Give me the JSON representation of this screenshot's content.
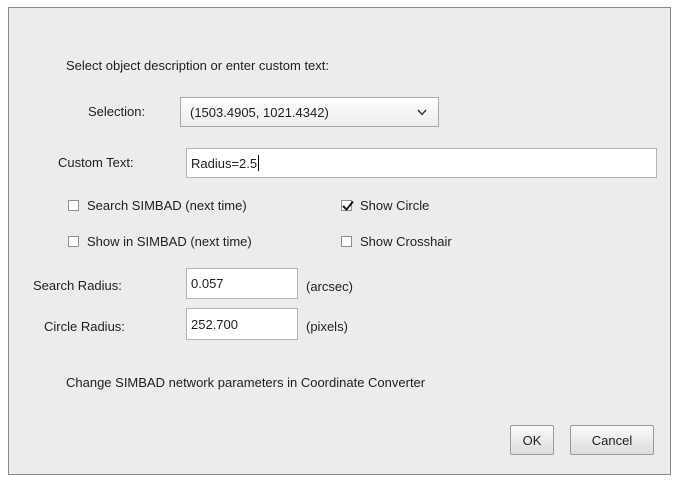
{
  "dialog": {
    "instructions": "Select object description or enter custom text:",
    "selection": {
      "label": "Selection:",
      "value": "(1503.4905, 1021.4342)",
      "arrow_icon": "chevron-down-icon"
    },
    "custom_text": {
      "label": "Custom Text:",
      "value": "Radius=2.5"
    },
    "checkboxes": {
      "search_simbad": {
        "label": "Search SIMBAD (next time)",
        "checked": false
      },
      "show_circle": {
        "label": "Show Circle",
        "checked": true
      },
      "show_in_simbad": {
        "label": "Show in SIMBAD (next time)",
        "checked": false
      },
      "show_crosshair": {
        "label": "Show Crosshair",
        "checked": false
      }
    },
    "search_radius": {
      "label": "Search Radius:",
      "value": "0.057",
      "unit": "(arcsec)"
    },
    "circle_radius": {
      "label": "Circle Radius:",
      "value": "252.700",
      "unit": "(pixels)"
    },
    "note": "Change SIMBAD network parameters in Coordinate Converter",
    "buttons": {
      "ok": "OK",
      "cancel": "Cancel"
    }
  }
}
